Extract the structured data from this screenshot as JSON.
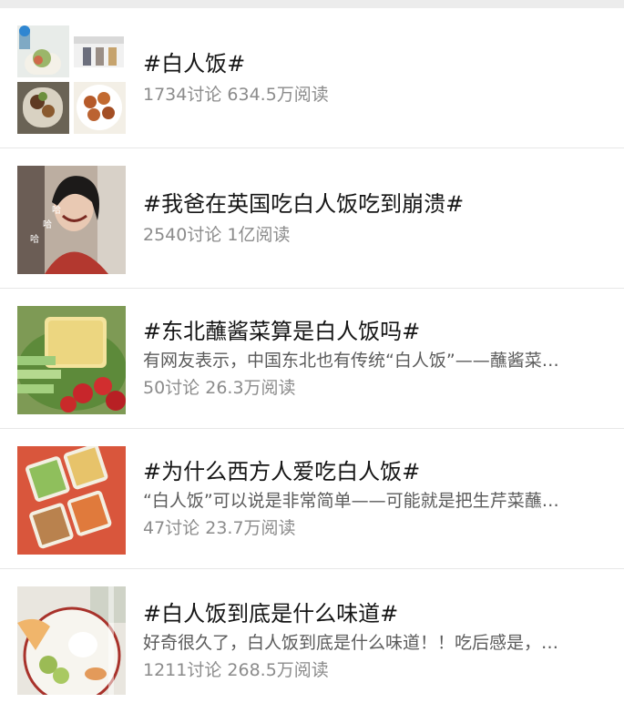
{
  "topics": [
    {
      "title": "#白人饭#",
      "discussions": "1734讨论",
      "reads": "634.5万阅读"
    },
    {
      "title": "#我爸在英国吃白人饭吃到崩溃#",
      "discussions": "2540讨论",
      "reads": "1亿阅读",
      "image_text": [
        "哈",
        "哈",
        "哈"
      ]
    },
    {
      "title": "#东北蘸酱菜算是白人饭吗#",
      "description": "有网友表示，中国东北也有传统“白人饭”——蘸酱菜…",
      "discussions": "50讨论",
      "reads": "26.3万阅读"
    },
    {
      "title": "#为什么西方人爱吃白人饭#",
      "description": "“白人饭”可以说是非常简单——可能就是把生芹菜蘸…",
      "discussions": "47讨论",
      "reads": "23.7万阅读"
    },
    {
      "title": "#白人饭到底是什么味道#",
      "description": "好奇很久了，白人饭到底是什么味道！！吃后感是，…",
      "discussions": "1211讨论",
      "reads": "268.5万阅读"
    }
  ]
}
